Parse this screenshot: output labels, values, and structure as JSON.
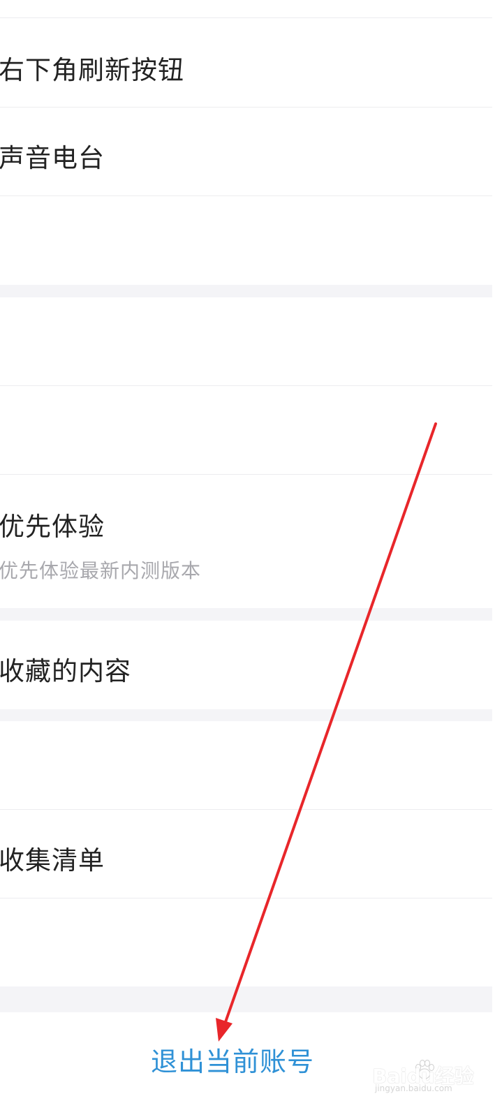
{
  "settings": {
    "rows": [
      {
        "label": "右下角刷新按钮"
      },
      {
        "label": "声音电台"
      },
      {
        "label": ""
      },
      {
        "label": ""
      },
      {
        "label": ""
      },
      {
        "label": "优先体验",
        "sublabel": "优先体验最新内测版本"
      },
      {
        "label": "收藏的内容"
      },
      {
        "label": ""
      },
      {
        "label": "收集清单"
      },
      {
        "label": ""
      }
    ]
  },
  "logout": {
    "label": "退出当前账号"
  },
  "watermark": {
    "brand": "Baidu经验",
    "sub": "jingyan.baidu.com"
  },
  "annotation": {
    "arrow_color": "#e8262a"
  }
}
